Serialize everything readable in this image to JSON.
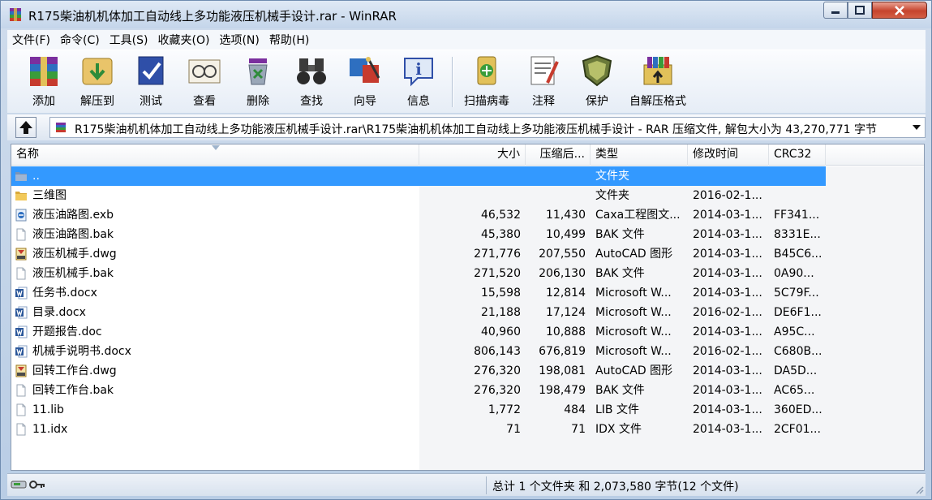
{
  "window": {
    "title": "R175柴油机机体加工自动线上多功能液压机械手设计.rar - WinRAR"
  },
  "menu": [
    "文件(F)",
    "命令(C)",
    "工具(S)",
    "收藏夹(O)",
    "选项(N)",
    "帮助(H)"
  ],
  "toolbar": {
    "add": "添加",
    "extract": "解压到",
    "test": "测试",
    "view": "查看",
    "delete": "删除",
    "find": "查找",
    "wizard": "向导",
    "info": "信息",
    "scan": "扫描病毒",
    "comment": "注释",
    "protect": "保护",
    "sfx": "自解压格式"
  },
  "address": {
    "path": "R175柴油机机体加工自动线上多功能液压机械手设计.rar\\R175柴油机机体加工自动线上多功能液压机械手设计 - RAR 压缩文件, 解包大小为 43,270,771 字节"
  },
  "columns": {
    "name": "名称",
    "size": "大小",
    "packed": "压缩后...",
    "type": "类型",
    "modified": "修改时间",
    "crc": "CRC32"
  },
  "files": [
    {
      "name": "..",
      "size": "",
      "packed": "",
      "type": "文件夹",
      "modified": "",
      "crc": "",
      "icon": "folder-up-icon"
    },
    {
      "name": "三维图",
      "size": "",
      "packed": "",
      "type": "文件夹",
      "modified": "2016-02-1...",
      "crc": "",
      "icon": "folder-icon"
    },
    {
      "name": "液压油路图.exb",
      "size": "46,532",
      "packed": "11,430",
      "type": "Caxa工程图文...",
      "modified": "2014-03-1...",
      "crc": "FF341...",
      "icon": "caxa-file-icon"
    },
    {
      "name": "液压油路图.bak",
      "size": "45,380",
      "packed": "10,499",
      "type": "BAK 文件",
      "modified": "2014-03-1...",
      "crc": "8331E...",
      "icon": "blank-file-icon"
    },
    {
      "name": "液压机械手.dwg",
      "size": "271,776",
      "packed": "207,550",
      "type": "AutoCAD 图形",
      "modified": "2014-03-1...",
      "crc": "B45C6...",
      "icon": "dwg-file-icon"
    },
    {
      "name": "液压机械手.bak",
      "size": "271,520",
      "packed": "206,130",
      "type": "BAK 文件",
      "modified": "2014-03-1...",
      "crc": "0A90...",
      "icon": "blank-file-icon"
    },
    {
      "name": "任务书.docx",
      "size": "15,598",
      "packed": "12,814",
      "type": "Microsoft W...",
      "modified": "2014-03-1...",
      "crc": "5C79F...",
      "icon": "word-file-icon"
    },
    {
      "name": "目录.docx",
      "size": "21,188",
      "packed": "17,124",
      "type": "Microsoft W...",
      "modified": "2016-02-1...",
      "crc": "DE6F1...",
      "icon": "word-file-icon"
    },
    {
      "name": "开题报告.doc",
      "size": "40,960",
      "packed": "10,888",
      "type": "Microsoft W...",
      "modified": "2014-03-1...",
      "crc": "A95C...",
      "icon": "word-file-icon"
    },
    {
      "name": "机械手说明书.docx",
      "size": "806,143",
      "packed": "676,819",
      "type": "Microsoft W...",
      "modified": "2016-02-1...",
      "crc": "C680B...",
      "icon": "word-file-icon"
    },
    {
      "name": "回转工作台.dwg",
      "size": "276,320",
      "packed": "198,081",
      "type": "AutoCAD 图形",
      "modified": "2014-03-1...",
      "crc": "DA5D...",
      "icon": "dwg-file-icon"
    },
    {
      "name": "回转工作台.bak",
      "size": "276,320",
      "packed": "198,479",
      "type": "BAK 文件",
      "modified": "2014-03-1...",
      "crc": "AC65...",
      "icon": "blank-file-icon"
    },
    {
      "name": "11.lib",
      "size": "1,772",
      "packed": "484",
      "type": "LIB 文件",
      "modified": "2014-03-1...",
      "crc": "360ED...",
      "icon": "blank-file-icon"
    },
    {
      "name": "11.idx",
      "size": "71",
      "packed": "71",
      "type": "IDX 文件",
      "modified": "2014-03-1...",
      "crc": "2CF01...",
      "icon": "blank-file-icon"
    }
  ],
  "status": {
    "summary": "总计 1 个文件夹 和 2,073,580 字节(12 个文件)"
  }
}
